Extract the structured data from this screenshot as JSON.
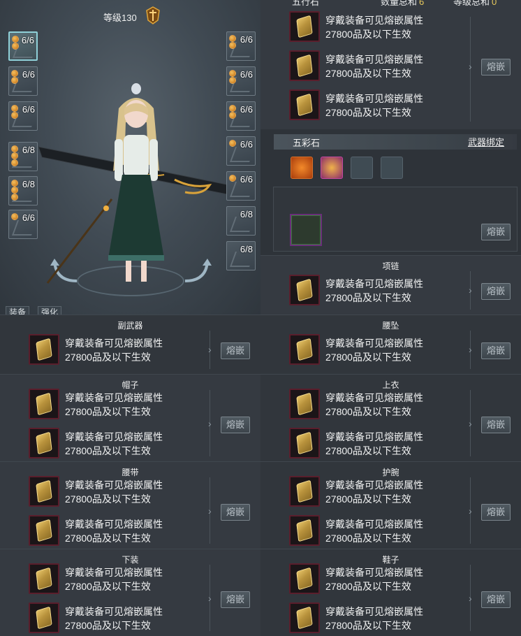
{
  "character": {
    "level_label": "等级130",
    "left_slots": [
      {
        "count": "6/6",
        "pips": 2,
        "selected": true
      },
      {
        "count": "6/6",
        "pips": 2
      },
      {
        "count": "6/6",
        "pips": 2
      },
      {
        "count": "6/8",
        "pips": 3
      },
      {
        "count": "6/8",
        "pips": 3
      },
      {
        "count": "6/6",
        "pips": 1
      }
    ],
    "right_slots": [
      {
        "count": "6/6",
        "pips": 2
      },
      {
        "count": "6/6",
        "pips": 2
      },
      {
        "count": "6/6",
        "pips": 2
      },
      {
        "count": "6/6",
        "pips": 1
      },
      {
        "count": "6/6",
        "pips": 1
      },
      {
        "count": "6/8",
        "pips": 0
      },
      {
        "count": "6/8",
        "pips": 0
      }
    ],
    "tabs": [
      "装备",
      "强化"
    ]
  },
  "top_header": {
    "left": "五行石",
    "middle": "数量总和",
    "middle_value": "6",
    "right": "等级总和",
    "right_value": "0"
  },
  "desc_line1": "穿戴装备可见熔嵌属性",
  "desc_line2": "27800品及以下生效",
  "inlay_label": "熔嵌",
  "wucai": {
    "title": "五彩石",
    "bind_label": "武器绑定"
  },
  "sections": [
    {
      "title": "副武器"
    },
    {
      "title": "帽子"
    },
    {
      "title": "腰带"
    },
    {
      "title": "下装"
    },
    {
      "title": "项链"
    },
    {
      "title": "腰坠"
    },
    {
      "title": "上衣"
    },
    {
      "title": "护腕"
    },
    {
      "title": "鞋子"
    }
  ],
  "colors": {
    "accent_gold": "#e6c85c",
    "frame_purple": "#5a1e2c",
    "bg": "#2e3339"
  }
}
